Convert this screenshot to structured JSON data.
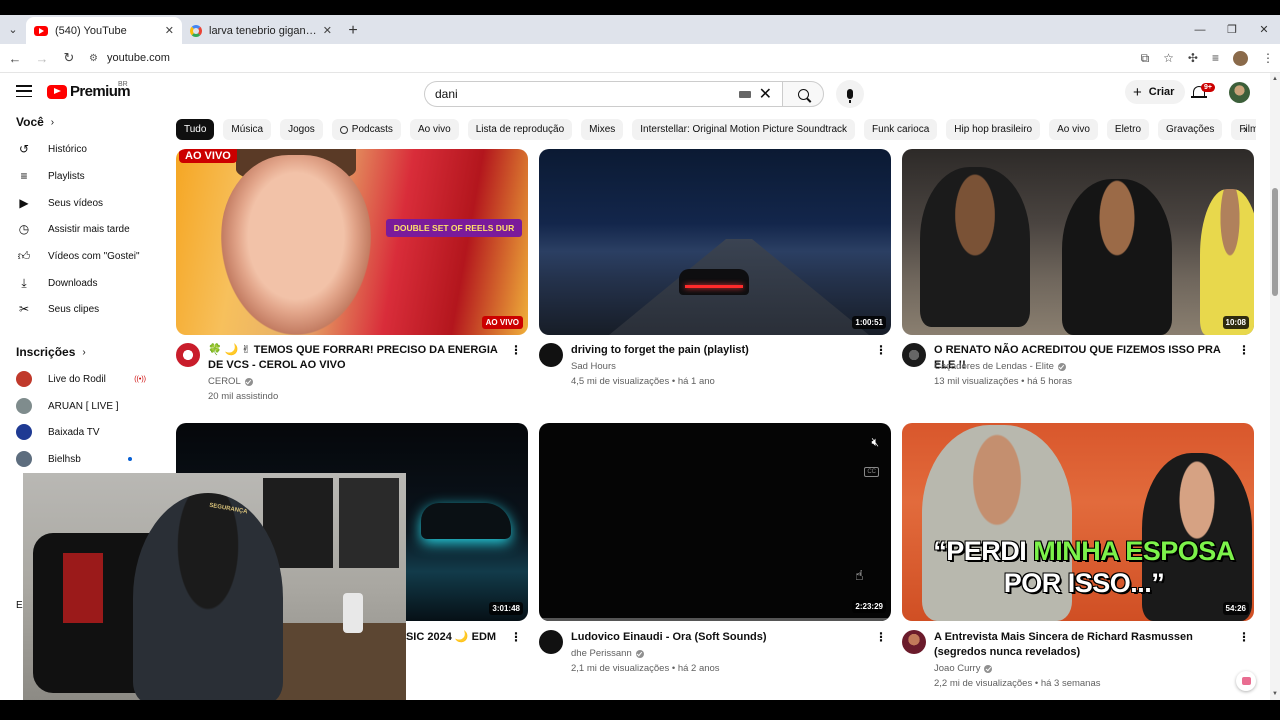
{
  "browser": {
    "tabs": [
      {
        "title": "(540) YouTube",
        "active": true
      },
      {
        "title": "larva tenebrio gigante - Pesquisa Google",
        "active": false
      }
    ],
    "url": "youtube.com"
  },
  "header": {
    "logo_text": "Premium",
    "country_code": "BR",
    "search_value": "dani",
    "create_label": "Criar",
    "notification_count": "9+"
  },
  "chips": [
    "Tudo",
    "Música",
    "Jogos",
    "Podcasts",
    "Ao vivo",
    "Lista de reprodução",
    "Mixes",
    "Interstellar: Original Motion Picture Soundtrack",
    "Funk carioca",
    "Hip hop brasileiro",
    "Ao vivo",
    "Eletro",
    "Gravações",
    "Filme de super-herói"
  ],
  "sidebar": {
    "you_header": "Você",
    "you_items": [
      "Histórico",
      "Playlists",
      "Seus vídeos",
      "Assistir mais tarde",
      "Vídeos com \"Gostei\"",
      "Downloads",
      "Seus clipes"
    ],
    "subs_header": "Inscrições",
    "subscriptions": [
      "Live do Rodil",
      "ARUAN [ LIVE ]",
      "Baixada TV",
      "Bielhsb"
    ],
    "cut_header": "E"
  },
  "videos": [
    {
      "title": "🍀 🌙 ✌ TEMOS QUE FORRAR! PRECISO DA ENERGIA DE VCS - CEROL AO VIVO",
      "channel": "CEROL",
      "stats": "20 mil assistindo",
      "badge": "AO VIVO",
      "overlay_top": "AO VIVO",
      "overlay_banner": "DOUBLE SET OF REELS DUR"
    },
    {
      "title": "driving to forget the pain (playlist)",
      "channel": "Sad Hours",
      "stats": "4,5 mi de visualizações • há 1 ano",
      "duration": "1:00:51"
    },
    {
      "title": "O RENATO NÃO ACREDITOU QUE FIZEMOS ISSO PRA ELE !!",
      "channel": "Caçadores de Lendas - Elite",
      "stats": "13 mil visualizações • há 5 horas",
      "duration": "10:08"
    },
    {
      "title_visible": "USIC 2024 🌙 EDM",
      "duration": "3:01:48"
    },
    {
      "title": "Ludovico Einaudi - Ora (Soft Sounds)",
      "channel": "dhe Perissann",
      "stats": "2,1 mi de visualizações • há 2 anos",
      "duration": "2:23:29"
    },
    {
      "title": "A Entrevista Mais Sincera de Richard Rasmussen (segredos nunca revelados)",
      "channel": "Joao Curry",
      "stats": "2,2 mi de visualizações • há 3 semanas",
      "duration": "54:26",
      "quote_white_1": "“PERDI ",
      "quote_green": "MINHA ESPOSA",
      "quote_white_2": "POR ISSO...”"
    }
  ],
  "webcam": {
    "cap_text": "SEGURANÇA"
  }
}
